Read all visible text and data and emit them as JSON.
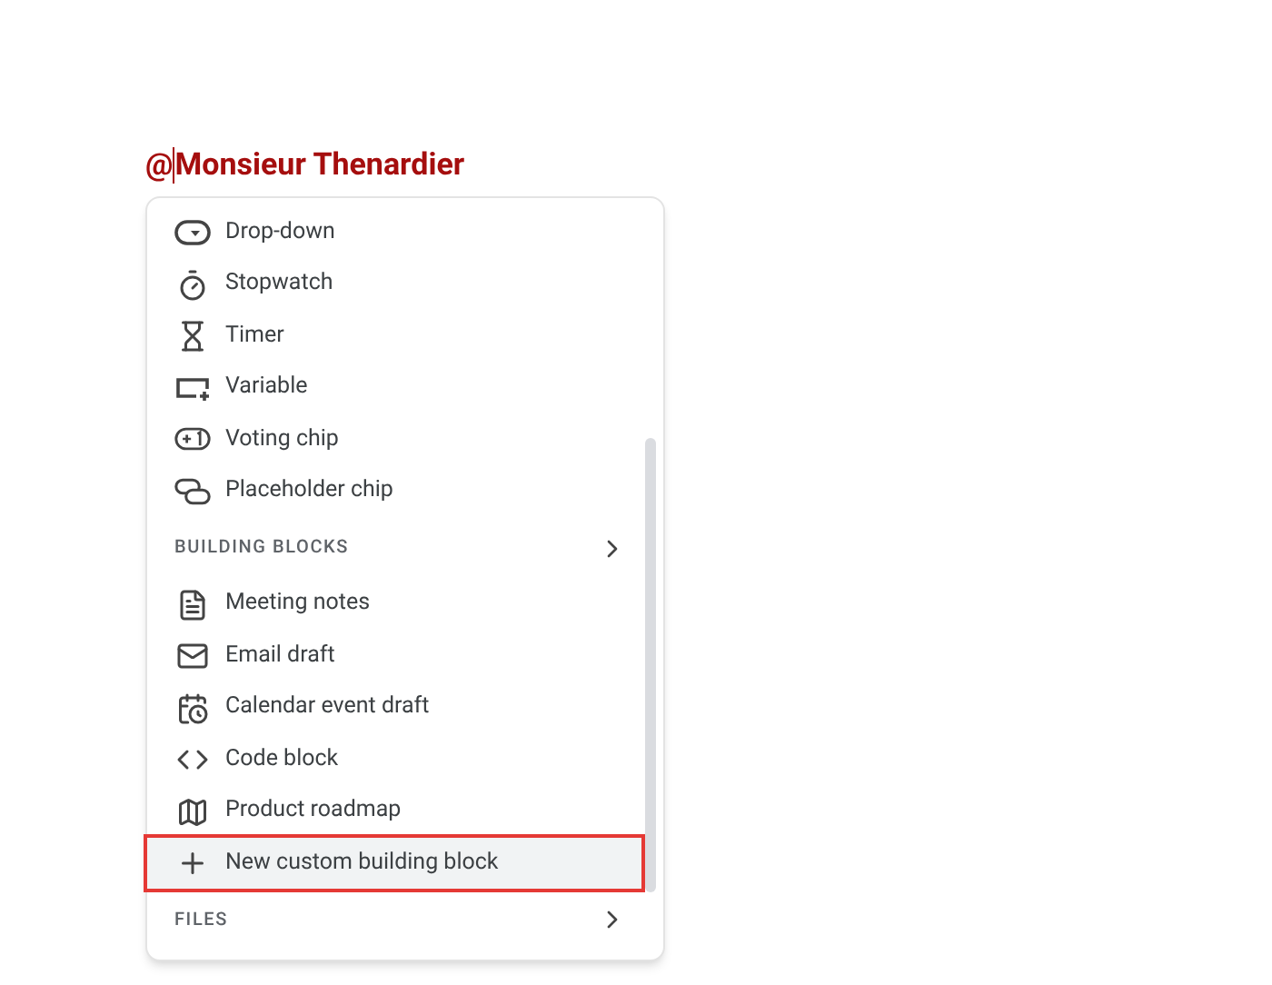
{
  "mention": "Monsieur Thenardier",
  "mention_prefix": "@",
  "menu": {
    "items": [
      {
        "kind": "item",
        "label": "Drop-down",
        "selected": false
      },
      {
        "kind": "item",
        "label": "Stopwatch",
        "selected": false
      },
      {
        "kind": "item",
        "label": "Timer",
        "selected": false
      },
      {
        "kind": "item",
        "label": "Variable",
        "selected": false
      },
      {
        "kind": "item",
        "label": "Voting chip",
        "selected": false
      },
      {
        "kind": "item",
        "label": "Placeholder chip",
        "selected": false
      },
      {
        "kind": "section",
        "label": "BUILDING BLOCKS"
      },
      {
        "kind": "item",
        "label": "Meeting notes",
        "selected": false
      },
      {
        "kind": "item",
        "label": "Email draft",
        "selected": false
      },
      {
        "kind": "item",
        "label": "Calendar event draft",
        "selected": false
      },
      {
        "kind": "item",
        "label": "Code block",
        "selected": false
      },
      {
        "kind": "item",
        "label": "Product roadmap",
        "selected": false
      },
      {
        "kind": "item",
        "label": "New custom building block",
        "selected": true
      },
      {
        "kind": "section",
        "label": "FILES"
      }
    ]
  }
}
